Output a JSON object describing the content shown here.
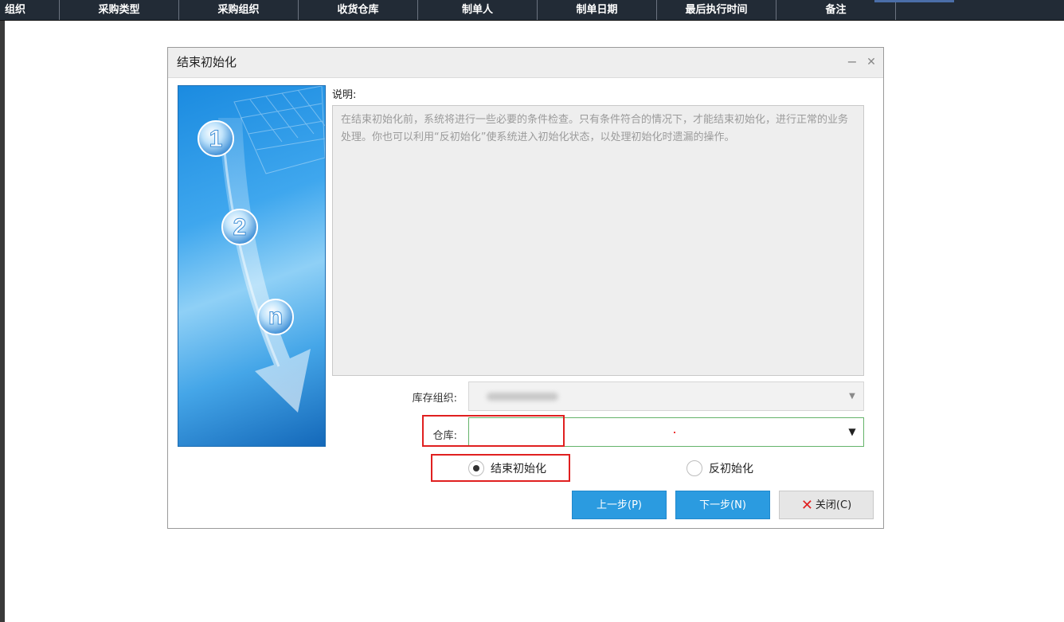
{
  "grid_header": {
    "columns": [
      "组织",
      "采购类型",
      "采购组织",
      "收货仓库",
      "制单人",
      "制单日期",
      "最后执行时间",
      "备注"
    ]
  },
  "dialog": {
    "title": "结束初始化",
    "minimize_glyph": "−",
    "close_glyph": "✕",
    "illustration_steps": [
      "1",
      "2",
      "n"
    ],
    "description_label": "说明:",
    "description_text": "在结束初始化前，系统将进行一些必要的条件检查。只有条件符合的情况下，才能结束初始化，进行正常的业务处理。你也可以利用“反初始化”使系统进入初始化状态，以处理初始化时遗漏的操作。",
    "org_label": "库存组织:",
    "warehouse_label": "仓库:",
    "warehouse_value": "",
    "radio_finish_label": "结束初始化",
    "radio_reverse_label": "反初始化",
    "selected_option": "结束初始化",
    "btn_prev": "上一步(P)",
    "btn_next": "下一步(N)",
    "btn_close": "关闭(C)"
  },
  "colors": {
    "header_bg": "#222b36",
    "button_blue": "#2b9be0",
    "highlight_red": "#e02020",
    "focus_green": "#64b36a"
  }
}
